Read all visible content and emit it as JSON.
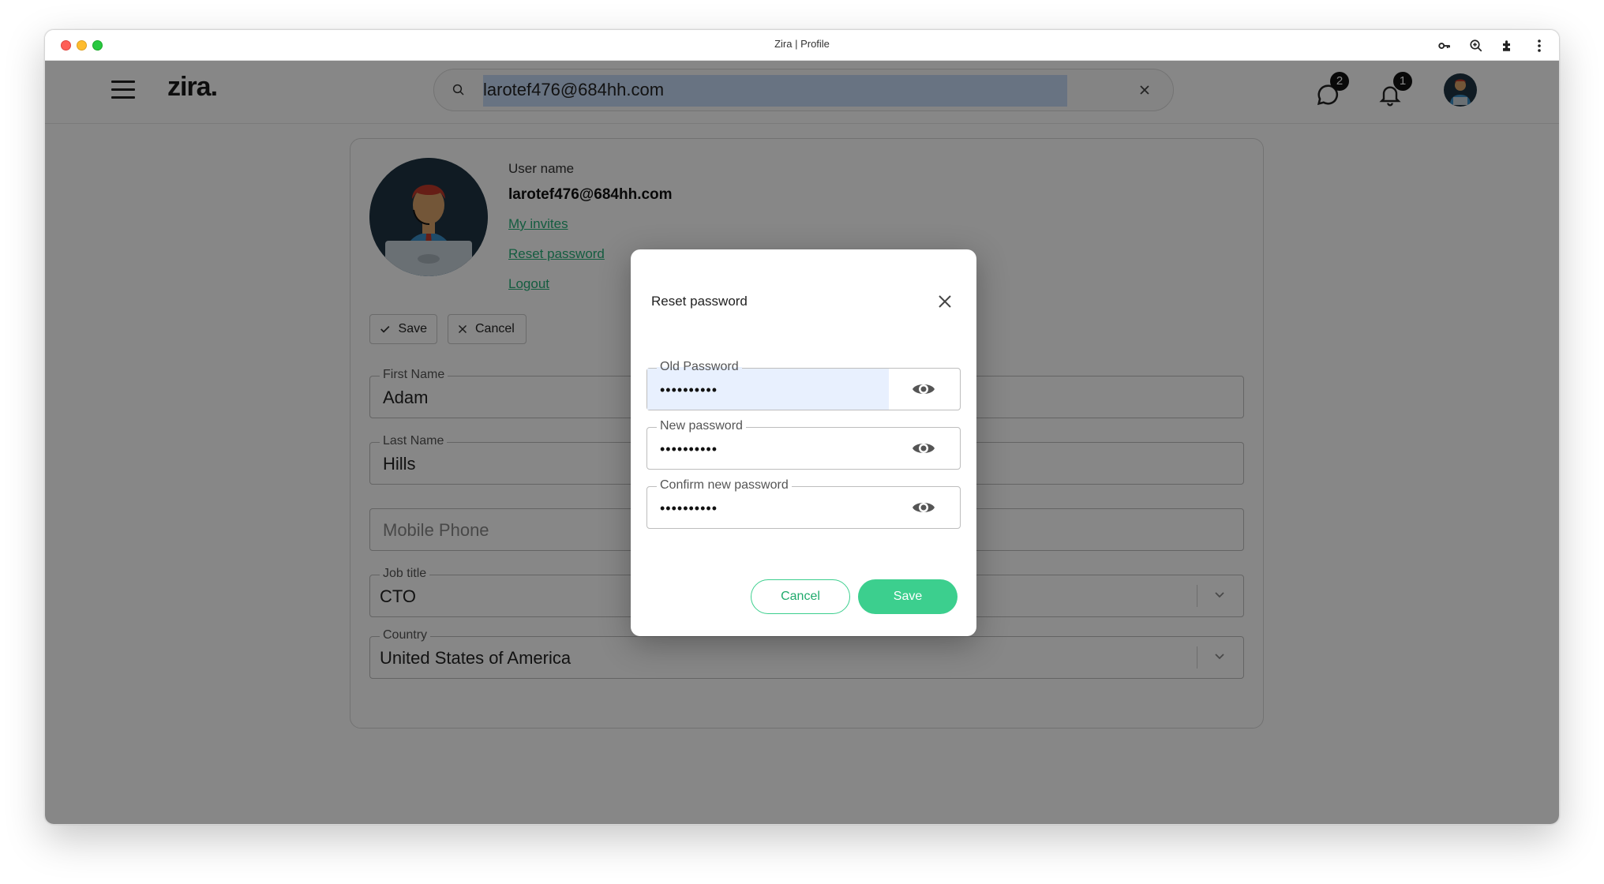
{
  "window": {
    "title": "Zira | Profile"
  },
  "header": {
    "logo": "zira.",
    "search_value": "larotef476@684hh.com",
    "chat_badge": "2",
    "notifications_badge": "1"
  },
  "profile": {
    "username_label": "User name",
    "username": "larotef476@684hh.com",
    "links": {
      "invites": "My invites",
      "reset_password": "Reset password",
      "logout": "Logout"
    },
    "save_label": "Save",
    "cancel_label": "Cancel",
    "fields": {
      "first_name": {
        "label": "First Name",
        "value": "Adam"
      },
      "last_name": {
        "label": "Last Name",
        "value": "Hills"
      },
      "mobile_phone": {
        "placeholder": "Mobile Phone"
      },
      "job_title": {
        "label": "Job title",
        "value": "CTO"
      },
      "country": {
        "label": "Country",
        "value": "United States of America"
      }
    }
  },
  "modal": {
    "title": "Reset password",
    "old_password": {
      "label": "Old Password",
      "value": "••••••••••"
    },
    "new_password": {
      "label": "New password",
      "value": "••••••••••"
    },
    "confirm_password": {
      "label": "Confirm new password",
      "value": "••••••••••"
    },
    "cancel_label": "Cancel",
    "save_label": "Save"
  },
  "colors": {
    "accent": "#3ccf8e",
    "link": "#27b07a",
    "overlay": "rgba(0,0,0,0.47)"
  },
  "icons": [
    "key-icon",
    "zoom-icon",
    "extension-icon",
    "more-vert-icon",
    "menu-icon",
    "search-icon",
    "clear-icon",
    "chat-icon",
    "bell-icon",
    "eye-icon",
    "close-icon",
    "check-icon",
    "chevron-down-icon"
  ]
}
